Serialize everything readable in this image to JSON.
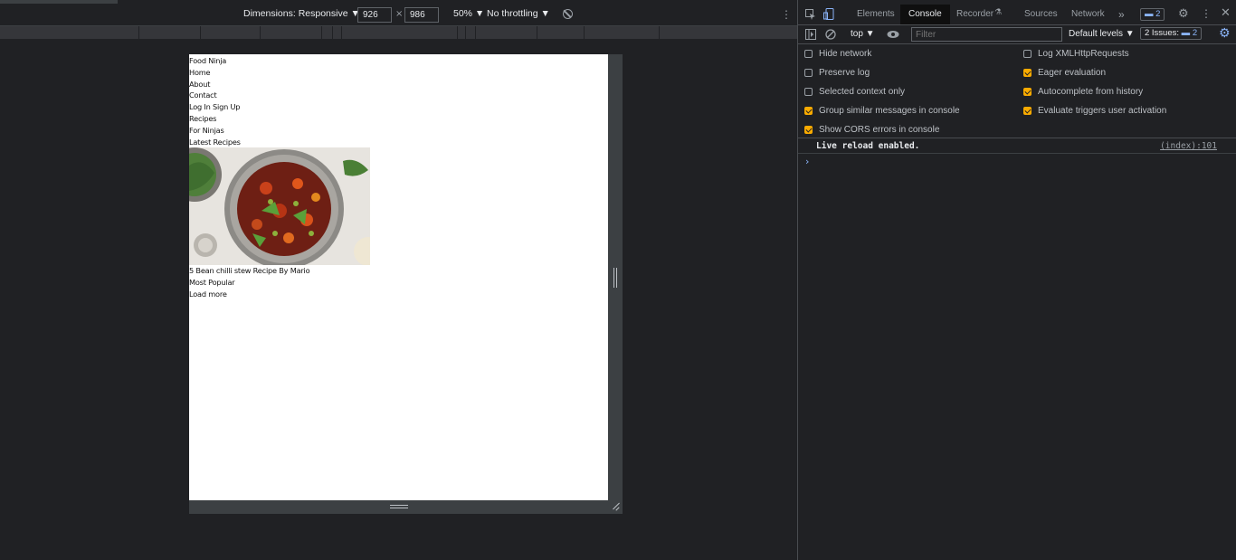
{
  "device_toolbar": {
    "dimensions_label": "Dimensions: Responsive ▼",
    "width_value": "926",
    "times": "×",
    "height_value": "986",
    "zoom_label": "50% ▼",
    "throttle_label": "No throttling ▼",
    "rotate_icon": "rotate-icon",
    "more_icon": "kebab-icon"
  },
  "site": {
    "brand": "Food Ninja",
    "nav": [
      "Home",
      "About",
      "Contact"
    ],
    "auth": "Log In Sign Up",
    "recipes": "Recipes",
    "for_ninjas": "For Ninjas",
    "latest_heading": "Latest Recipes",
    "hero_caption": "5 Bean chilli stew Recipe By Mario",
    "most_popular": "Most Popular",
    "load_more": "Load more"
  },
  "devtools": {
    "tabs": [
      "Elements",
      "Console",
      "Recorder",
      "Sources",
      "Network"
    ],
    "active_tab": "Console",
    "overflow": "»",
    "messages_badge": "2",
    "context": "top ▼",
    "filter_placeholder": "Filter",
    "levels": "Default levels ▼",
    "issues_label": "2 Issues:",
    "issues_count": "2",
    "settings_left": [
      {
        "label": "Hide network",
        "checked": false
      },
      {
        "label": "Preserve log",
        "checked": false
      },
      {
        "label": "Selected context only",
        "checked": false
      },
      {
        "label": "Group similar messages in console",
        "checked": true
      },
      {
        "label": "Show CORS errors in console",
        "checked": true
      }
    ],
    "settings_right": [
      {
        "label": "Log XMLHttpRequests",
        "checked": false
      },
      {
        "label": "Eager evaluation",
        "checked": true
      },
      {
        "label": "Autocomplete from history",
        "checked": true
      },
      {
        "label": "Evaluate triggers user activation",
        "checked": true
      }
    ],
    "console_message": "Live reload enabled.",
    "console_source": "(index):101",
    "prompt": "›"
  },
  "colors": {
    "accent": "#8ab4f8",
    "checkbox_on": "#f9ab00",
    "panel_bg": "#202124"
  }
}
